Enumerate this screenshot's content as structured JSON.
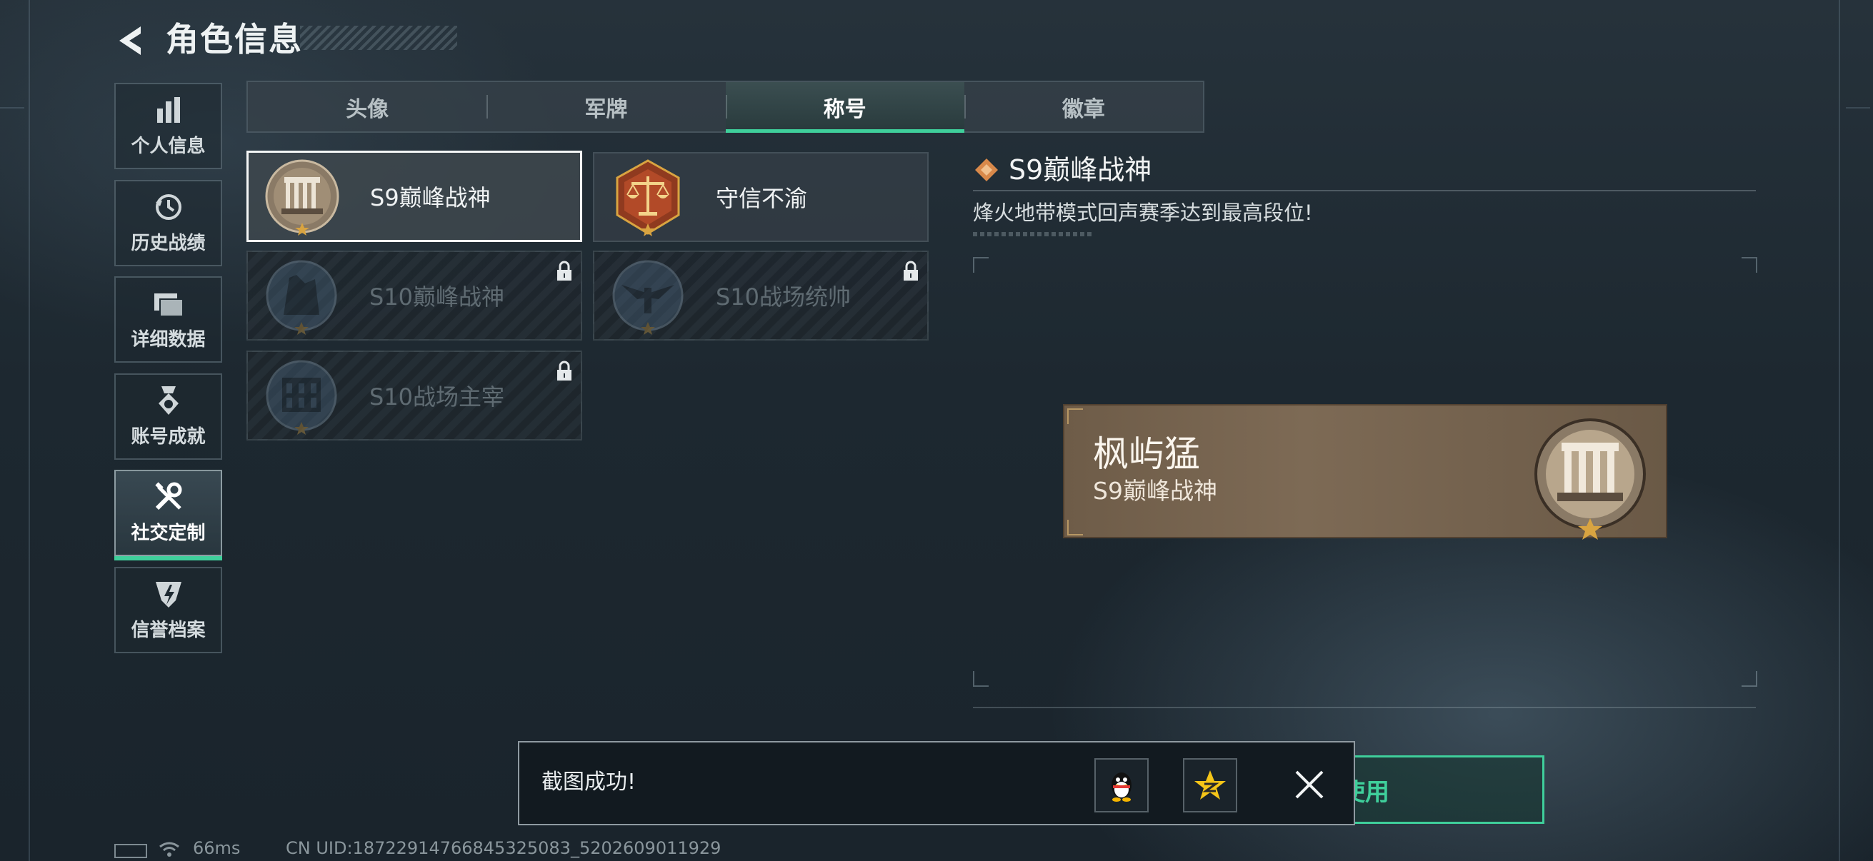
{
  "header": {
    "title": "角色信息"
  },
  "sidebar": {
    "items": [
      {
        "label": "个人信息",
        "icon": "bar-chart-icon"
      },
      {
        "label": "历史战绩",
        "icon": "history-clock-icon"
      },
      {
        "label": "详细数据",
        "icon": "folders-icon"
      },
      {
        "label": "账号成就",
        "icon": "medal-icon"
      },
      {
        "label": "社交定制",
        "icon": "tools-icon",
        "active": true
      },
      {
        "label": "信誉档案",
        "icon": "shield-bolt-icon"
      }
    ]
  },
  "tabs": [
    {
      "label": "头像"
    },
    {
      "label": "军牌"
    },
    {
      "label": "称号",
      "active": true
    },
    {
      "label": "徽章"
    }
  ],
  "titles": [
    {
      "name": "S9巅峰战神",
      "locked": false,
      "selected": true,
      "emblem": "building-emblem"
    },
    {
      "name": "守信不渝",
      "locked": false,
      "selected": false,
      "emblem": "scales-emblem"
    },
    {
      "name": "S10巅峰战神",
      "locked": true,
      "emblem": "monument-emblem"
    },
    {
      "name": "S10战场统帅",
      "locked": true,
      "emblem": "aircraft-emblem"
    },
    {
      "name": "S10战场主宰",
      "locked": true,
      "emblem": "colosseum-emblem"
    }
  ],
  "detail": {
    "title": "S9巅峰战神",
    "description": "烽火地带模式回声赛季达到最高段位!"
  },
  "preview": {
    "player_name": "枫屿猛",
    "title": "S9巅峰战神"
  },
  "use_button": {
    "label": "使用"
  },
  "toast": {
    "message": "截图成功!"
  },
  "status": {
    "ping": "66ms",
    "uid": "CN UID:18722914766845325083_5202609011929"
  },
  "colors": {
    "accent": "#3fcf9b",
    "plate": "#7d6a55",
    "emblem_gold": "#d9a441"
  }
}
